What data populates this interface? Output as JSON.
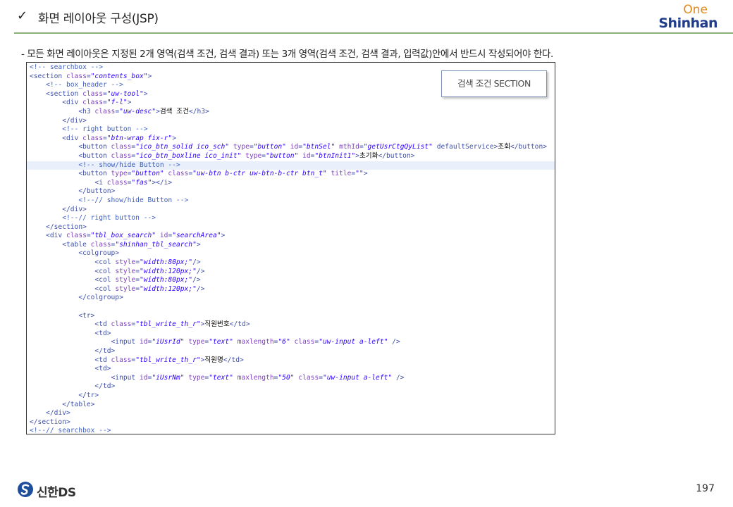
{
  "header": {
    "check_glyph": "✓",
    "title": "화면 레이아웃 구성(JSP)",
    "logo_one": "One",
    "logo_shinhan": "Shinhan"
  },
  "description": "- 모든 화면 레이아웃은 지정된 2개 영역(검색 조건, 검색 결과) 또는 3개 영역(검색 조건, 검색 결과, 입력값)안에서 반드시 작성되어야 한다.",
  "section_label": "검색 조건 SECTION",
  "code_lines": [
    {
      "t": "<!-- searchbox -->"
    },
    {
      "t": "<section class=\"contents_box\">"
    },
    {
      "t": "    <!-- box_header -->"
    },
    {
      "t": "    <section class=\"uw-tool\">"
    },
    {
      "t": "        <div class=\"f-l\">"
    },
    {
      "t": "            <h3 class=\"uw-desc\">검색 조건</h3>"
    },
    {
      "t": "        </div>"
    },
    {
      "t": "        <!-- right button -->"
    },
    {
      "t": "        <div class=\"btn-wrap fix-r\">"
    },
    {
      "t": "            <button class=\"ico_btn_solid ico_sch\" type=\"button\" id=\"btnSel\" mthId=\"getUsrCtgQyList\" defaultService>조회</button>"
    },
    {
      "t": "            <button class=\"ico_btn_boxline ico_init\" type=\"button\" id=\"btnInit1\">초기화</button>"
    },
    {
      "t": "            <!-- show/hide Button -->",
      "hl": true
    },
    {
      "t": "            <button type=\"button\" class=\"uw-btn b-ctr uw-btn-b-ctr btn_t\" title=\"\">"
    },
    {
      "t": "                <i class=\"fas\"></i>"
    },
    {
      "t": "            </button>"
    },
    {
      "t": "            <!--// show/hide Button -->"
    },
    {
      "t": "        </div>"
    },
    {
      "t": "        <!--// right button -->"
    },
    {
      "t": "    </section>"
    },
    {
      "t": "    <div class=\"tbl_box_search\" id=\"searchArea\">"
    },
    {
      "t": "        <table class=\"shinhan_tbl_search\">"
    },
    {
      "t": "            <colgroup>"
    },
    {
      "t": "                <col style=\"width:80px;\"/>"
    },
    {
      "t": "                <col style=\"width:120px;\"/>"
    },
    {
      "t": "                <col style=\"width:80px;\"/>"
    },
    {
      "t": "                <col style=\"width:120px;\"/>"
    },
    {
      "t": "            </colgroup>"
    },
    {
      "t": ""
    },
    {
      "t": "            <tr>"
    },
    {
      "t": "                <td class=\"tbl_write_th_r\">직원번호</td>"
    },
    {
      "t": "                <td>"
    },
    {
      "t": "                    <input id=\"iUsrId\" type=\"text\" maxlength=\"6\" class=\"uw-input a-left\" />"
    },
    {
      "t": "                </td>"
    },
    {
      "t": "                <td class=\"tbl_write_th_r\">직원명</td>"
    },
    {
      "t": "                <td>"
    },
    {
      "t": "                    <input id=\"iUsrNm\" type=\"text\" maxlength=\"50\" class=\"uw-input a-left\" />"
    },
    {
      "t": "                </td>"
    },
    {
      "t": "            </tr>"
    },
    {
      "t": "        </table>"
    },
    {
      "t": "    </div>"
    },
    {
      "t": "</section>"
    },
    {
      "t": "<!--// searchbox -->"
    }
  ],
  "footer": {
    "logo_text": "신한DS",
    "page_number": "197"
  },
  "colors": {
    "header_rule": "#8bb07a",
    "logo_one": "#e38a1a",
    "logo_shinhan": "#1f3d8a"
  }
}
